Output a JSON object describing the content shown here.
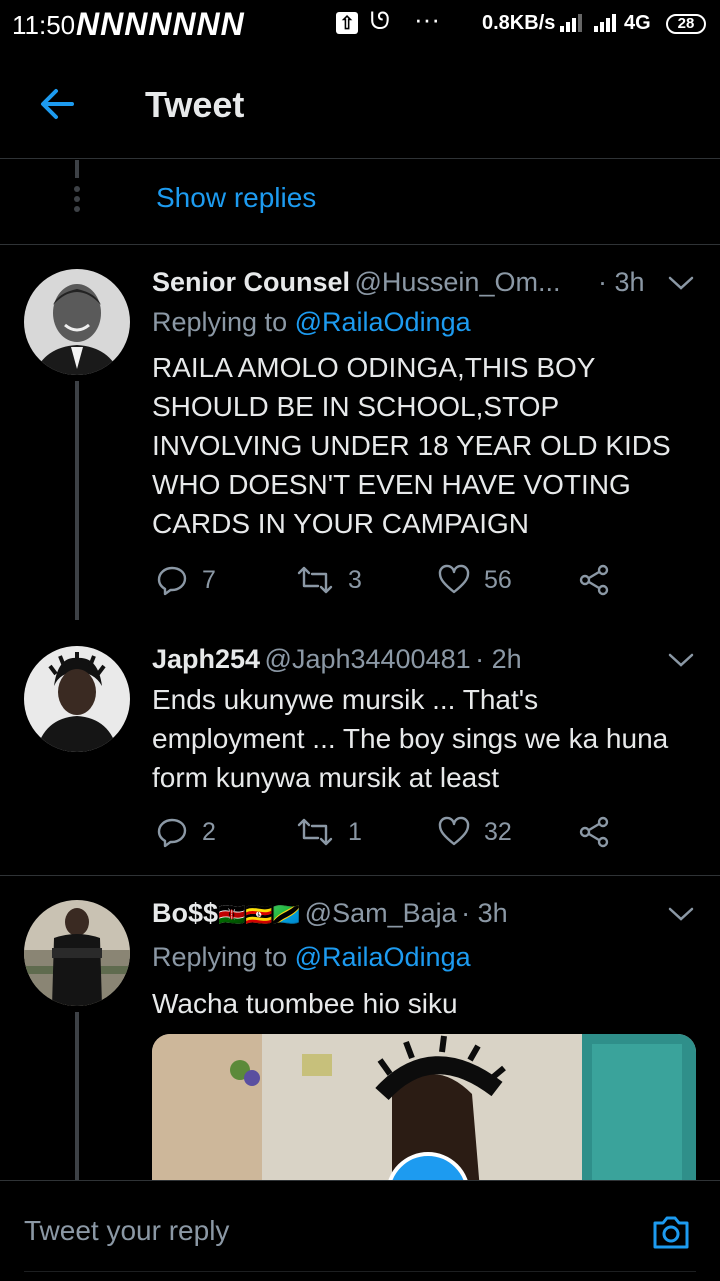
{
  "status_bar": {
    "time": "11:50",
    "notification_glyphs": "NNNNNNN",
    "upload_glyph": "⇧",
    "face_glyph": "ᘎ",
    "more_glyph": "···",
    "speed": "0.8KB/s",
    "network": "4G",
    "battery": "28"
  },
  "header": {
    "title": "Tweet"
  },
  "show_replies": {
    "label": "Show replies"
  },
  "tweets": [
    {
      "name": "Senior Counsel",
      "handle": "@Hussein_Om...",
      "time": "· 3h",
      "replying_prefix": "Replying to",
      "replying_handle": "@RailaOdinga",
      "text": "RAILA AMOLO ODINGA,THIS BOY SHOULD BE IN SCHOOL,STOP INVOLVING UNDER 18 YEAR OLD KIDS WHO DOESN'T EVEN HAVE VOTING CARDS IN YOUR CAMPAIGN",
      "replies": "7",
      "retweets": "3",
      "likes": "56"
    },
    {
      "name": "Japh254",
      "handle": "@Japh34400481",
      "time": "· 2h",
      "text": "Ends ukunywe mursik ... That's employment ... The boy sings we ka huna form kunywa mursik at least",
      "replies": "2",
      "retweets": "1",
      "likes": "32"
    },
    {
      "name": "Bo$$",
      "flags": "🇰🇪🇺🇬🇹🇿",
      "handle": "@Sam_Baja",
      "time": "· 3h",
      "replying_prefix": "Replying to",
      "replying_handle": "@RailaOdinga",
      "text": "Wacha tuombee hio siku"
    }
  ],
  "reply_bar": {
    "placeholder": "Tweet your reply"
  },
  "colors": {
    "accent": "#1d9bf0",
    "muted": "#8b98a5",
    "background": "#000000"
  }
}
